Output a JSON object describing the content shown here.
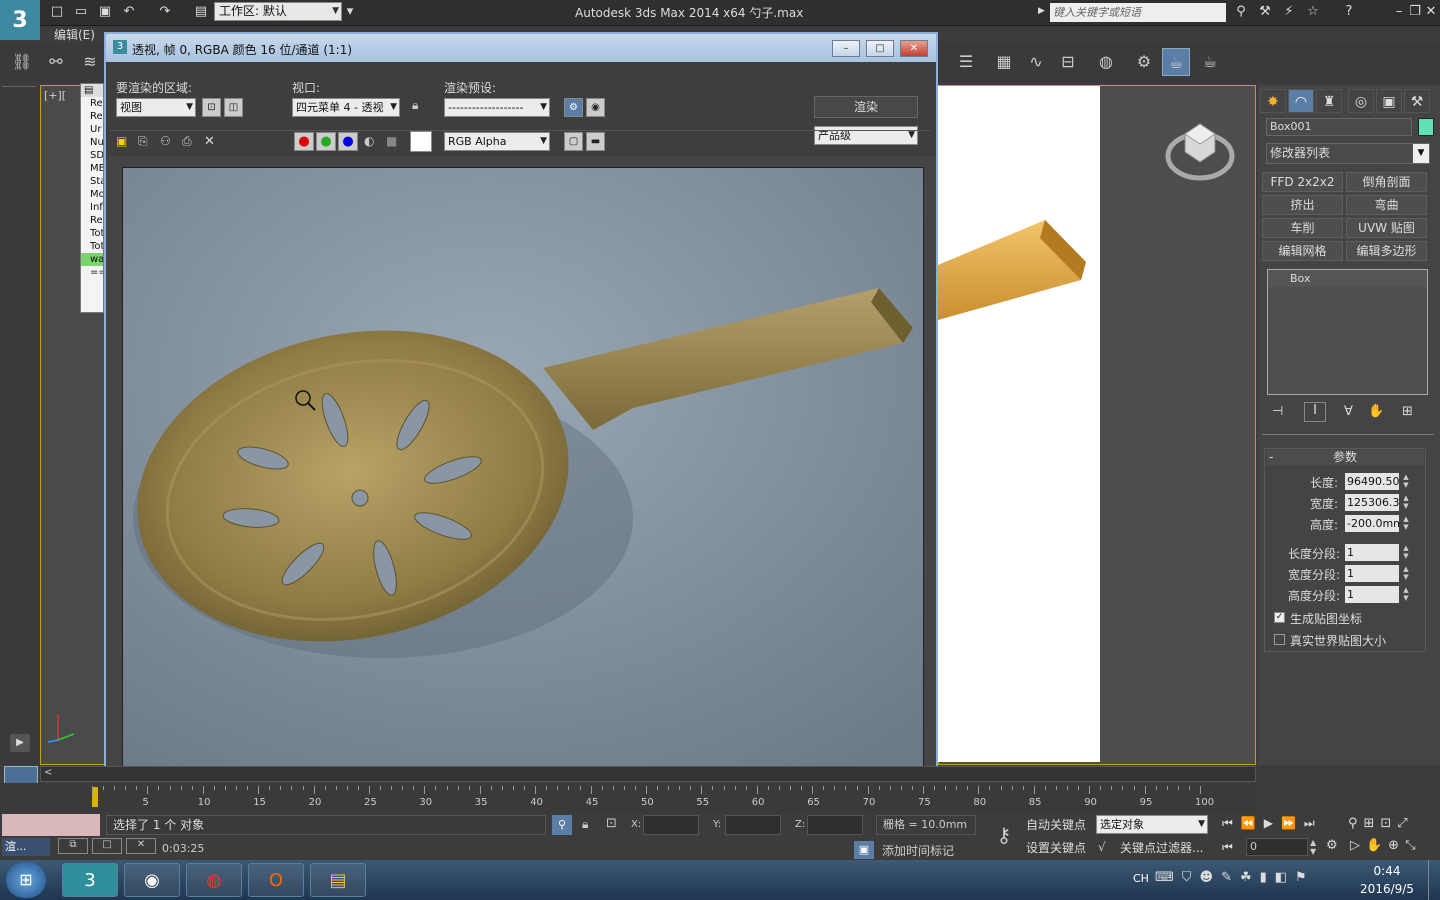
{
  "app": {
    "title": "Autodesk 3ds Max  2014 x64      勺子.max",
    "workspace_label": "工作区: 默认",
    "search_placeholder": "键入关键字或短语",
    "menu_edit": "编辑(E)",
    "viewport_label": "[+][",
    "listener_lines": [
      "Re",
      "Re",
      "Ur",
      "Num",
      "SD",
      "ME",
      "Sta",
      "Mo",
      "Inf",
      "Reg",
      "Tota",
      "Tota",
      "wan",
      "==="
    ]
  },
  "render_window": {
    "title": "透视, 帧 0, RGBA 颜色 16 位/通道 (1:1)",
    "area_label": "要渲染的区域:",
    "area_value": "视图",
    "viewport_label": "视口:",
    "viewport_value": "四元菜单 4 - 透视",
    "preset_label": "渲染预设:",
    "preset_value": "-------------------",
    "render_button": "渲染",
    "quality_value": "产品级",
    "channel_value": "RGB Alpha"
  },
  "command_panel": {
    "object_name": "Box001",
    "object_color": "#5fe0b8",
    "modifier_list": "修改器列表",
    "modifier_buttons": [
      "FFD 2x2x2",
      "倒角剖面",
      "挤出",
      "弯曲",
      "车削",
      "UVW 贴图",
      "编辑网格",
      "编辑多边形"
    ],
    "stack_item": "Box",
    "params_title": "参数",
    "params": [
      {
        "label": "长度:",
        "value": "96490.50"
      },
      {
        "label": "宽度:",
        "value": "125306.3"
      },
      {
        "label": "高度:",
        "value": "-200.0mm"
      }
    ],
    "segments": [
      {
        "label": "长度分段:",
        "value": "1"
      },
      {
        "label": "宽度分段:",
        "value": "1"
      },
      {
        "label": "高度分段:",
        "value": "1"
      }
    ],
    "check1": "生成贴图坐标",
    "check2": "真实世界贴图大小"
  },
  "timeline": {
    "ticks": [
      "5",
      "10",
      "15",
      "20",
      "25",
      "30",
      "35",
      "40",
      "45",
      "50",
      "55",
      "60",
      "65",
      "70",
      "75",
      "80",
      "85",
      "90",
      "95",
      "100"
    ]
  },
  "status": {
    "selection": "选择了 1 个 对象",
    "time": "0:03:25",
    "x_label": "X:",
    "y_label": "Y:",
    "z_label": "Z:",
    "grid": "栅格 = 10.0mm",
    "add_time_tag": "添加时间标记",
    "auto_key": "自动关键点",
    "set_key": "设置关键点",
    "selected_obj": "选定对象",
    "key_filters": "关键点过滤器...",
    "frame": "0",
    "mini_task": "渲..."
  },
  "taskbar": {
    "clock_time": "0:44",
    "clock_date": "2016/9/5",
    "lang": "CH"
  }
}
